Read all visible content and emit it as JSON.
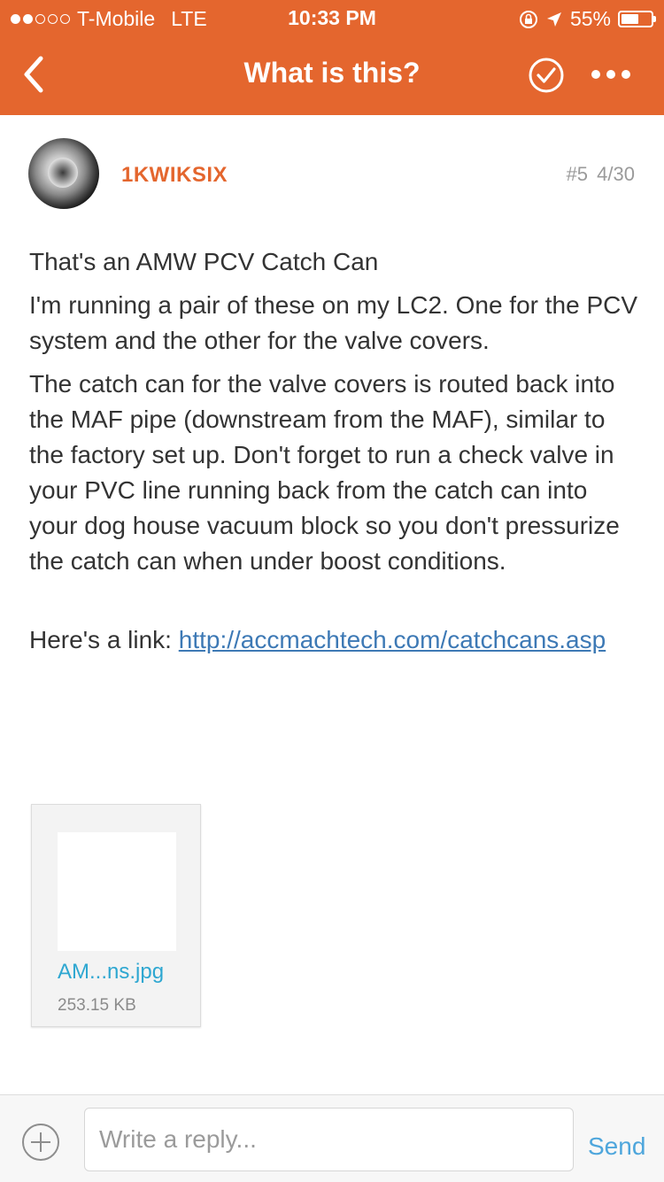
{
  "status_bar": {
    "carrier": "T-Mobile",
    "network": "LTE",
    "time": "10:33 PM",
    "battery": "55%",
    "battery_level": 0.55,
    "signal_bars_filled": 2,
    "signal_bars_total": 5
  },
  "nav": {
    "title": "What is this?",
    "back_icon": "chevron-left-icon",
    "check_icon": "check-circle-icon",
    "more_icon": "ellipsis-icon"
  },
  "post": {
    "username": "1KWIKSIX",
    "post_number": "#5",
    "date": "4/30",
    "paragraphs": [
      "That's an AMW PCV Catch Can",
      "I'm running a pair of these on my LC2. One for the PCV system and the other for the valve covers.",
      "The catch can for the valve covers is routed back into the MAF pipe (downstream from the MAF), similar to the factory set up. Don't forget to run a check valve in your PVC line running back from the catch can into your dog house vacuum block so you don't pressurize the catch can when under boost conditions."
    ],
    "link_prefix": "Here's a link: ",
    "link_text": "http://accmachtech.com/catchcans.asp",
    "attachment": {
      "filename": "AM...ns.jpg",
      "size": "253.15 KB"
    }
  },
  "reply": {
    "placeholder": "Write a reply...",
    "send_label": "Send",
    "add_icon": "plus-circle-icon"
  },
  "colors": {
    "accent": "#E4662E",
    "link": "#3D79B5",
    "attachment_name": "#2EA7D1",
    "send": "#4EA6DC"
  }
}
